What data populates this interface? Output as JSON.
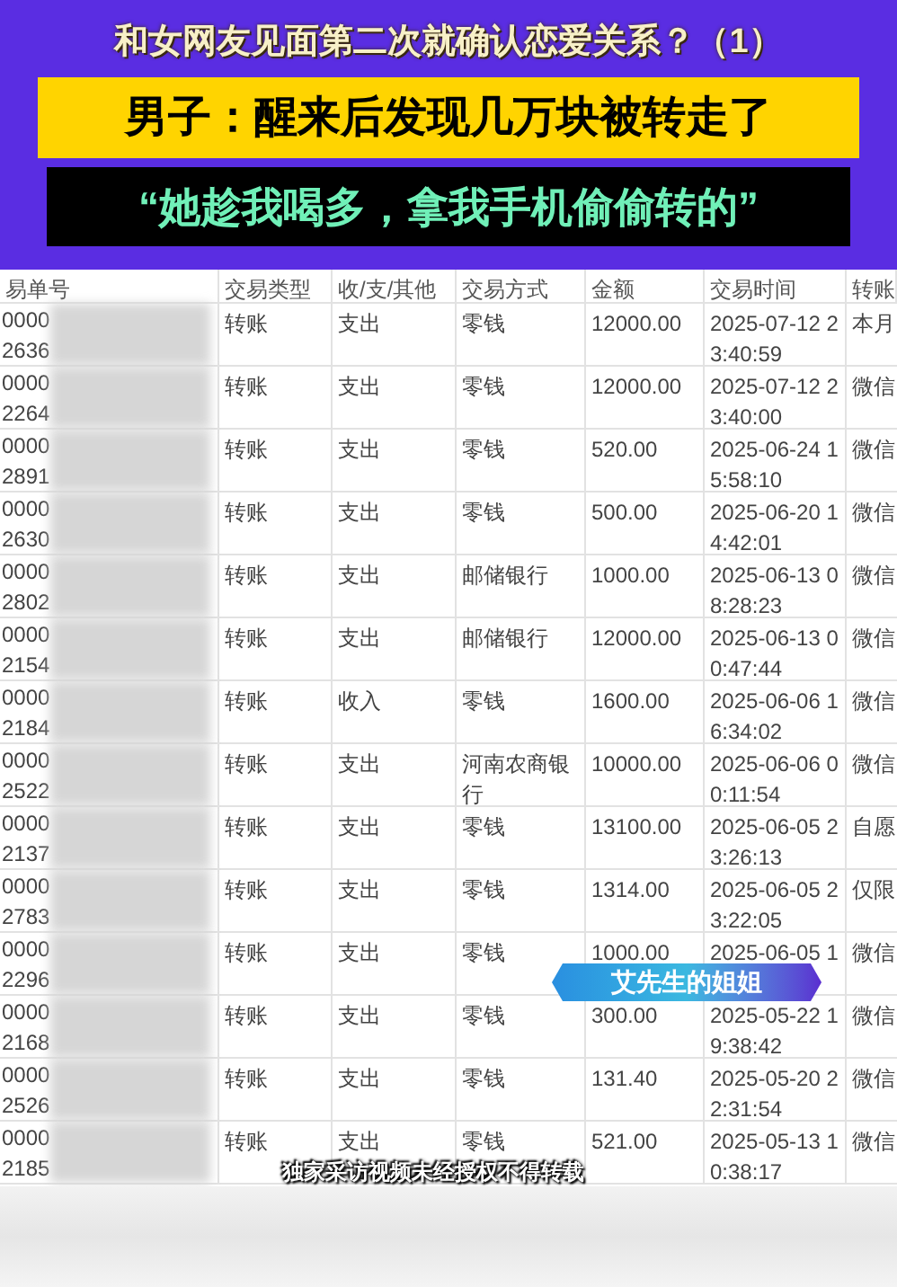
{
  "headline": "和女网友见面第二次就确认恋爱关系？（1）",
  "banner": "男子：醒来后发现几万块被转走了",
  "quote": "“她趁我喝多，拿我手机偷偷转的”",
  "table": {
    "columns": [
      "易单号",
      "交易类型",
      "收/支/其他",
      "交易方式",
      "金额",
      "交易时间",
      "转账"
    ],
    "rows": [
      {
        "id": [
          "0000",
          "2636"
        ],
        "type": "转账",
        "direction": "支出",
        "method": "零钱",
        "amount": "12000.00",
        "time": [
          "2025-07-12 2",
          "3:40:59"
        ],
        "column_7": "本月"
      },
      {
        "id": [
          "0000",
          "2264"
        ],
        "type": "转账",
        "direction": "支出",
        "method": "零钱",
        "amount": "12000.00",
        "time": [
          "2025-07-12 2",
          "3:40:00"
        ],
        "column_7": "微信"
      },
      {
        "id": [
          "0000",
          "2891"
        ],
        "type": "转账",
        "direction": "支出",
        "method": "零钱",
        "amount": "520.00",
        "time": [
          "2025-06-24 1",
          "5:58:10"
        ],
        "column_7": "微信"
      },
      {
        "id": [
          "0000",
          "2630"
        ],
        "type": "转账",
        "direction": "支出",
        "method": "零钱",
        "amount": "500.00",
        "time": [
          "2025-06-20 1",
          "4:42:01"
        ],
        "column_7": "微信"
      },
      {
        "id": [
          "0000",
          "2802"
        ],
        "type": "转账",
        "direction": "支出",
        "method": "邮储银行",
        "amount": "1000.00",
        "time": [
          "2025-06-13 0",
          "8:28:23"
        ],
        "column_7": "微信"
      },
      {
        "id": [
          "0000",
          "2154"
        ],
        "type": "转账",
        "direction": "支出",
        "method": "邮储银行",
        "amount": "12000.00",
        "time": [
          "2025-06-13 0",
          "0:47:44"
        ],
        "column_7": "微信"
      },
      {
        "id": [
          "0000",
          "2184"
        ],
        "type": "转账",
        "direction": "收入",
        "method": "零钱",
        "amount": "1600.00",
        "time": [
          "2025-06-06 1",
          "6:34:02"
        ],
        "column_7": "微信"
      },
      {
        "id": [
          "0000",
          "2522"
        ],
        "type": "转账",
        "direction": "支出",
        "method": "河南农商银行",
        "amount": "10000.00",
        "time": [
          "2025-06-06 0",
          "0:11:54"
        ],
        "column_7": "微信"
      },
      {
        "id": [
          "0000",
          "2137"
        ],
        "type": "转账",
        "direction": "支出",
        "method": "零钱",
        "amount": "13100.00",
        "time": [
          "2025-06-05 2",
          "3:26:13"
        ],
        "column_7": "自愿"
      },
      {
        "id": [
          "0000",
          "2783"
        ],
        "type": "转账",
        "direction": "支出",
        "method": "零钱",
        "amount": "1314.00",
        "time": [
          "2025-06-05 2",
          "3:22:05"
        ],
        "column_7": "仅限"
      },
      {
        "id": [
          "0000",
          "2296"
        ],
        "type": "转账",
        "direction": "支出",
        "method": "零钱",
        "amount": "1000.00",
        "time": [
          "2025-06-05 1"
        ],
        "column_7": "微信"
      },
      {
        "id": [
          "0000",
          "2168"
        ],
        "type": "转账",
        "direction": "支出",
        "method": "零钱",
        "amount": "300.00",
        "time": [
          "2025-05-22 1",
          "9:38:42"
        ],
        "column_7": "微信"
      },
      {
        "id": [
          "0000",
          "2526"
        ],
        "type": "转账",
        "direction": "支出",
        "method": "零钱",
        "amount": "131.40",
        "time": [
          "2025-05-20 2",
          "2:31:54"
        ],
        "column_7": "微信"
      },
      {
        "id": [
          "0000",
          "2185"
        ],
        "type": "转账",
        "direction": "支出",
        "method": "零钱",
        "amount": "521.00",
        "time": [
          "2025-05-13 1",
          "0:38:17"
        ],
        "column_7": "微信"
      }
    ]
  },
  "speaker_label": "艾先生的姐姐",
  "caption": "独家采访视频未经授权不得转载"
}
